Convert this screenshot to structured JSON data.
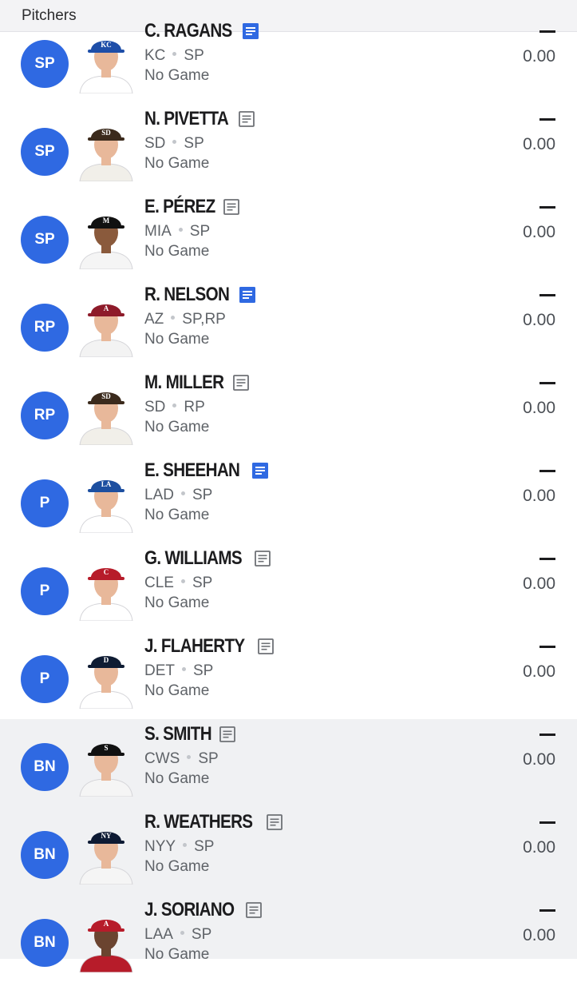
{
  "section_title": "Pitchers",
  "note_icon_colors": {
    "active": "#2f69e2",
    "inactive": "#6e7176"
  },
  "position_circle_color": "#2f69e2",
  "players": [
    {
      "slot": "SP",
      "name": "C. RAGANS",
      "team": "KC",
      "positions": "SP",
      "game": "No Game",
      "stat": "—",
      "points": "0.00",
      "note": "active",
      "cap_color": "#1e4ea8",
      "cap_logo": "KC",
      "jersey": "#ffffff"
    },
    {
      "slot": "SP",
      "name": "N. PIVETTA",
      "team": "SD",
      "positions": "SP",
      "game": "No Game",
      "stat": "—",
      "points": "0.00",
      "note": "inactive",
      "cap_color": "#3b2a1c",
      "cap_logo": "SD",
      "jersey": "#f1efe9"
    },
    {
      "slot": "SP",
      "name": "E. PÉREZ",
      "team": "MIA",
      "positions": "SP",
      "game": "No Game",
      "stat": "—",
      "points": "0.00",
      "note": "inactive",
      "cap_color": "#111111",
      "cap_logo": "M",
      "jersey": "#f5f5f5"
    },
    {
      "slot": "RP",
      "name": "R. NELSON",
      "team": "AZ",
      "positions": "SP,RP",
      "game": "No Game",
      "stat": "—",
      "points": "0.00",
      "note": "active",
      "cap_color": "#8e1b2a",
      "cap_logo": "A",
      "jersey": "#f3f3f3"
    },
    {
      "slot": "RP",
      "name": "M. MILLER",
      "team": "SD",
      "positions": "RP",
      "game": "No Game",
      "stat": "—",
      "points": "0.00",
      "note": "inactive",
      "cap_color": "#3b2a1c",
      "cap_logo": "SD",
      "jersey": "#f1efe9"
    },
    {
      "slot": "P",
      "name": "E. SHEEHAN",
      "team": "LAD",
      "positions": "SP",
      "game": "No Game",
      "stat": "—",
      "points": "0.00",
      "note": "active",
      "cap_color": "#1d4fa0",
      "cap_logo": "LA",
      "jersey": "#ffffff"
    },
    {
      "slot": "P",
      "name": "G. WILLIAMS",
      "team": "CLE",
      "positions": "SP",
      "game": "No Game",
      "stat": "—",
      "points": "0.00",
      "note": "inactive",
      "cap_color": "#b71c2a",
      "cap_logo": "C",
      "jersey": "#ffffff"
    },
    {
      "slot": "P",
      "name": "J. FLAHERTY",
      "team": "DET",
      "positions": "SP",
      "game": "No Game",
      "stat": "—",
      "points": "0.00",
      "note": "inactive",
      "cap_color": "#0f1c33",
      "cap_logo": "D",
      "jersey": "#ffffff"
    },
    {
      "slot": "BN",
      "name": "S. SMITH",
      "team": "CWS",
      "positions": "SP",
      "game": "No Game",
      "stat": "—",
      "points": "0.00",
      "note": "inactive",
      "cap_color": "#111111",
      "cap_logo": "S",
      "jersey": "#f5f5f5"
    },
    {
      "slot": "BN",
      "name": "R. WEATHERS",
      "team": "NYY",
      "positions": "SP",
      "game": "No Game",
      "stat": "—",
      "points": "0.00",
      "note": "inactive",
      "cap_color": "#0d1a33",
      "cap_logo": "NY",
      "jersey": "#f5f5f5"
    },
    {
      "slot": "BN",
      "name": "J. SORIANO",
      "team": "LAA",
      "positions": "SP",
      "game": "No Game",
      "stat": "—",
      "points": "0.00",
      "note": "inactive",
      "cap_color": "#b71c2a",
      "cap_logo": "A",
      "jersey": "#b71c2a"
    }
  ]
}
